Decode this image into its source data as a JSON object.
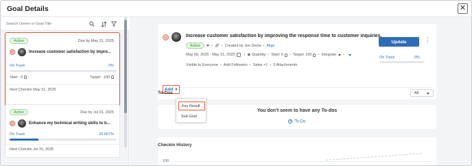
{
  "header": {
    "title": "Goal Details",
    "close_icon": "close-icon"
  },
  "search": {
    "placeholder": "Search Owner or Goal Title"
  },
  "cards": [
    {
      "status": "Active",
      "due": "Due by May 31, 2025",
      "title": "Increase customer satisfaction by impro...",
      "on_track": "On Track",
      "percent": "0%",
      "progress": 0,
      "start": "Start : 0",
      "target": "Target : 100",
      "next_checkin": "Next Checkin May 31, 2025",
      "selected": true
    },
    {
      "status": "Active",
      "due": "Due by Jul 31, 2025",
      "title": "Enhance my technical writing skills to b...",
      "on_track": "On Track",
      "percent": "26.667%",
      "progress": 0.26667,
      "next_checkin": "Next Checkin Jul 31, 2025",
      "selected": false
    }
  ],
  "goal": {
    "title": "Increase customer satisfaction by improving the response time to customer inquiries.",
    "status": "Active",
    "created_by": "Created by Jon Snow",
    "align": "Align",
    "dates": "May 06, 2025 - May 31, 2025",
    "quantity": "Quantity",
    "start": "Start: 0",
    "target": "Target: 100",
    "integrate": "Integrate",
    "visible": "Visible to Everyone",
    "add_followers": "Add Followers",
    "sales": "Sales +1",
    "attachments": "0 Attachments",
    "update": "Update",
    "on_track": "On Track",
    "percent": "0%",
    "progress": 0
  },
  "add_menu": {
    "label": "Add",
    "items": [
      "Key Result",
      "Sub Goal"
    ]
  },
  "todos": {
    "label": "To-Dos",
    "filter": "All",
    "empty": "You don't seem to have any To-dos",
    "link": "To-Do"
  },
  "history": {
    "title": "Checkin History",
    "y_tick": "100"
  },
  "colors": {
    "accent": "#2f6bb5",
    "highlight": "#e8542f",
    "active": "#2e8b3a"
  }
}
